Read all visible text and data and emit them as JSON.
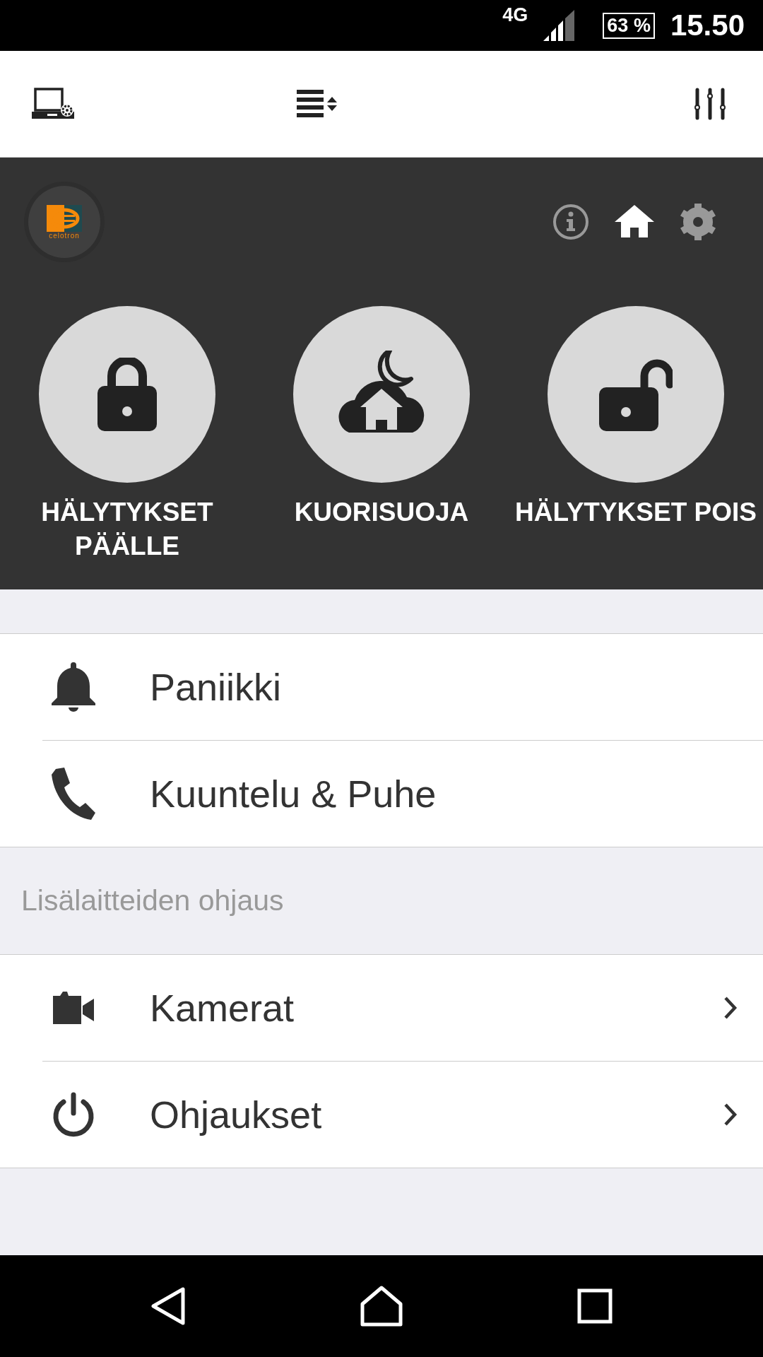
{
  "status_bar": {
    "network": "4G",
    "battery": "63 %",
    "time": "15.50"
  },
  "toolbar": {
    "items": [
      {
        "kind": "device"
      },
      {
        "kind": "list-sort"
      },
      {
        "kind": "sliders"
      }
    ]
  },
  "header": {
    "logo_text": "celotron",
    "nav": [
      {
        "kind": "info",
        "selected": false
      },
      {
        "kind": "home",
        "selected": true
      },
      {
        "kind": "settings",
        "selected": false
      }
    ],
    "modes": [
      {
        "kind": "lock",
        "label": "HÄLYTYKSET PÄÄLLE"
      },
      {
        "kind": "night",
        "label": "KUORISUOJA"
      },
      {
        "kind": "unlock",
        "label": "HÄLYTYKSET POIS"
      }
    ]
  },
  "actions": [
    {
      "kind": "bell",
      "label": "Paniikki",
      "chevron": false
    },
    {
      "kind": "phone",
      "label": "Kuuntelu & Puhe",
      "chevron": false
    }
  ],
  "section": {
    "title": "Lisälaitteiden ohjaus",
    "items": [
      {
        "kind": "camera",
        "label": "Kamerat",
        "chevron": true
      },
      {
        "kind": "power",
        "label": "Ohjaukset",
        "chevron": true
      }
    ]
  }
}
